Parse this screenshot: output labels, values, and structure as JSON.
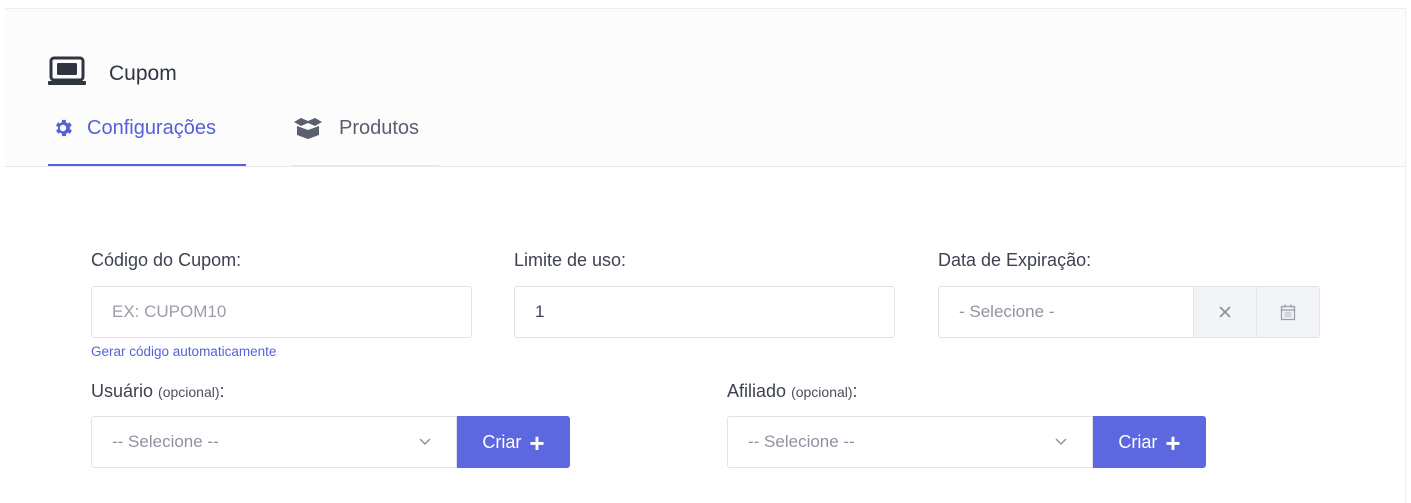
{
  "header": {
    "title": "Cupom",
    "title_icon": "ticket-icon"
  },
  "tabs": [
    {
      "label": "Configurações",
      "icon": "gear-icon",
      "active": true
    },
    {
      "label": "Produtos",
      "icon": "boxes-icon",
      "active": false
    }
  ],
  "form": {
    "codigo": {
      "label": "Código do Cupom:",
      "placeholder": "EX: CUPOM10",
      "value": "",
      "generate_link": "Gerar código automaticamente"
    },
    "limite": {
      "label": "Limite de uso:",
      "value": "1"
    },
    "expiracao": {
      "label": "Data de Expiração:",
      "placeholder": "- Selecione -",
      "clear_icon": "close-icon",
      "calendar_icon": "calendar-icon"
    },
    "usuario": {
      "label": "Usuário",
      "optional": "(opcional)",
      "colon": ":",
      "selected": "-- Selecione --",
      "button": "Criar"
    },
    "afiliado": {
      "label": "Afiliado",
      "optional": "(opcional)",
      "colon": ":",
      "selected": "-- Selecione --",
      "button": "Criar"
    }
  },
  "colors": {
    "accent": "#5660d8",
    "button": "#5d67e0"
  }
}
